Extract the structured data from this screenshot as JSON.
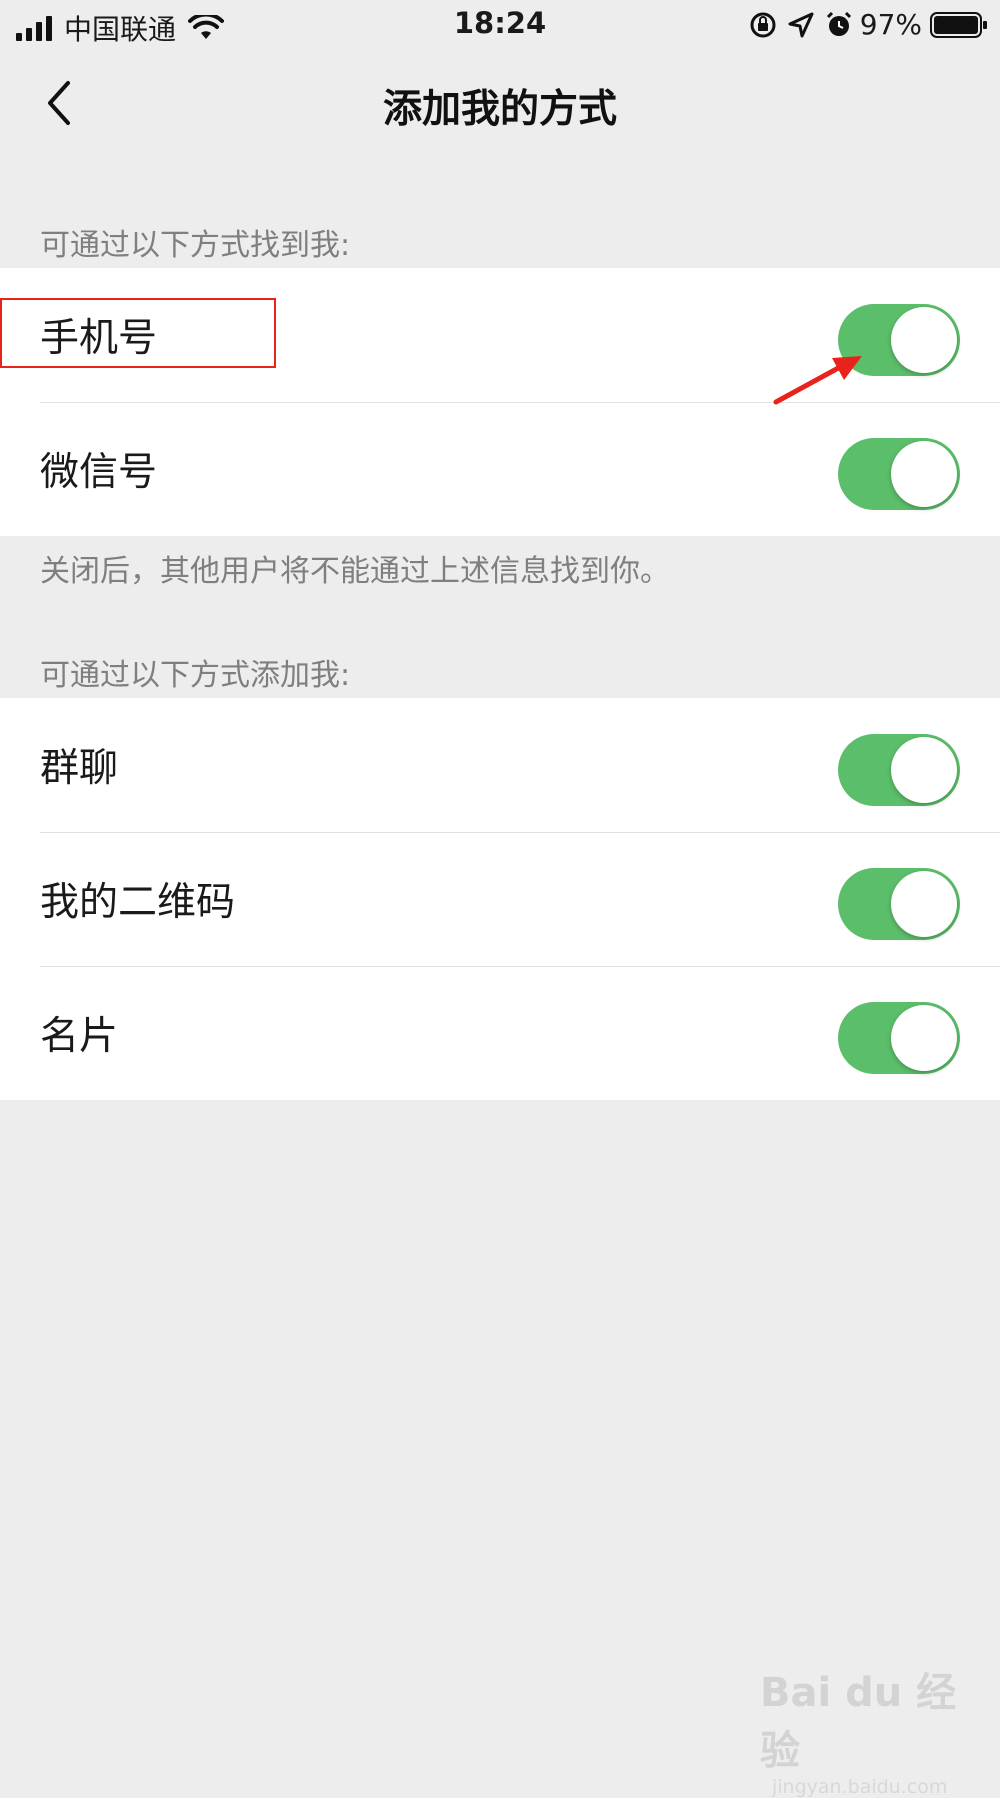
{
  "status_bar": {
    "carrier": "中国联通",
    "time": "18:24",
    "battery": "97%",
    "icons": [
      "signal-icon",
      "wifi-icon",
      "rotation-lock-icon",
      "location-icon",
      "alarm-icon",
      "battery-icon"
    ]
  },
  "nav": {
    "back_icon": "chevron-left-icon",
    "title": "添加我的方式"
  },
  "find_section": {
    "header": "可通过以下方式找到我:",
    "items": [
      {
        "label": "手机号",
        "on": true
      },
      {
        "label": "微信号",
        "on": true
      }
    ],
    "footer": "关闭后，其他用户将不能通过上述信息找到你。"
  },
  "add_section": {
    "header": "可通过以下方式添加我:",
    "items": [
      {
        "label": "群聊",
        "on": true
      },
      {
        "label": "我的二维码",
        "on": true
      },
      {
        "label": "名片",
        "on": true
      }
    ]
  },
  "colors": {
    "switch_on": "#5bbe6a",
    "annotation": "#e8231b",
    "background": "#ededed"
  },
  "watermark": {
    "logo": "Bai du 经验",
    "url": "jingyan.baidu.com"
  }
}
